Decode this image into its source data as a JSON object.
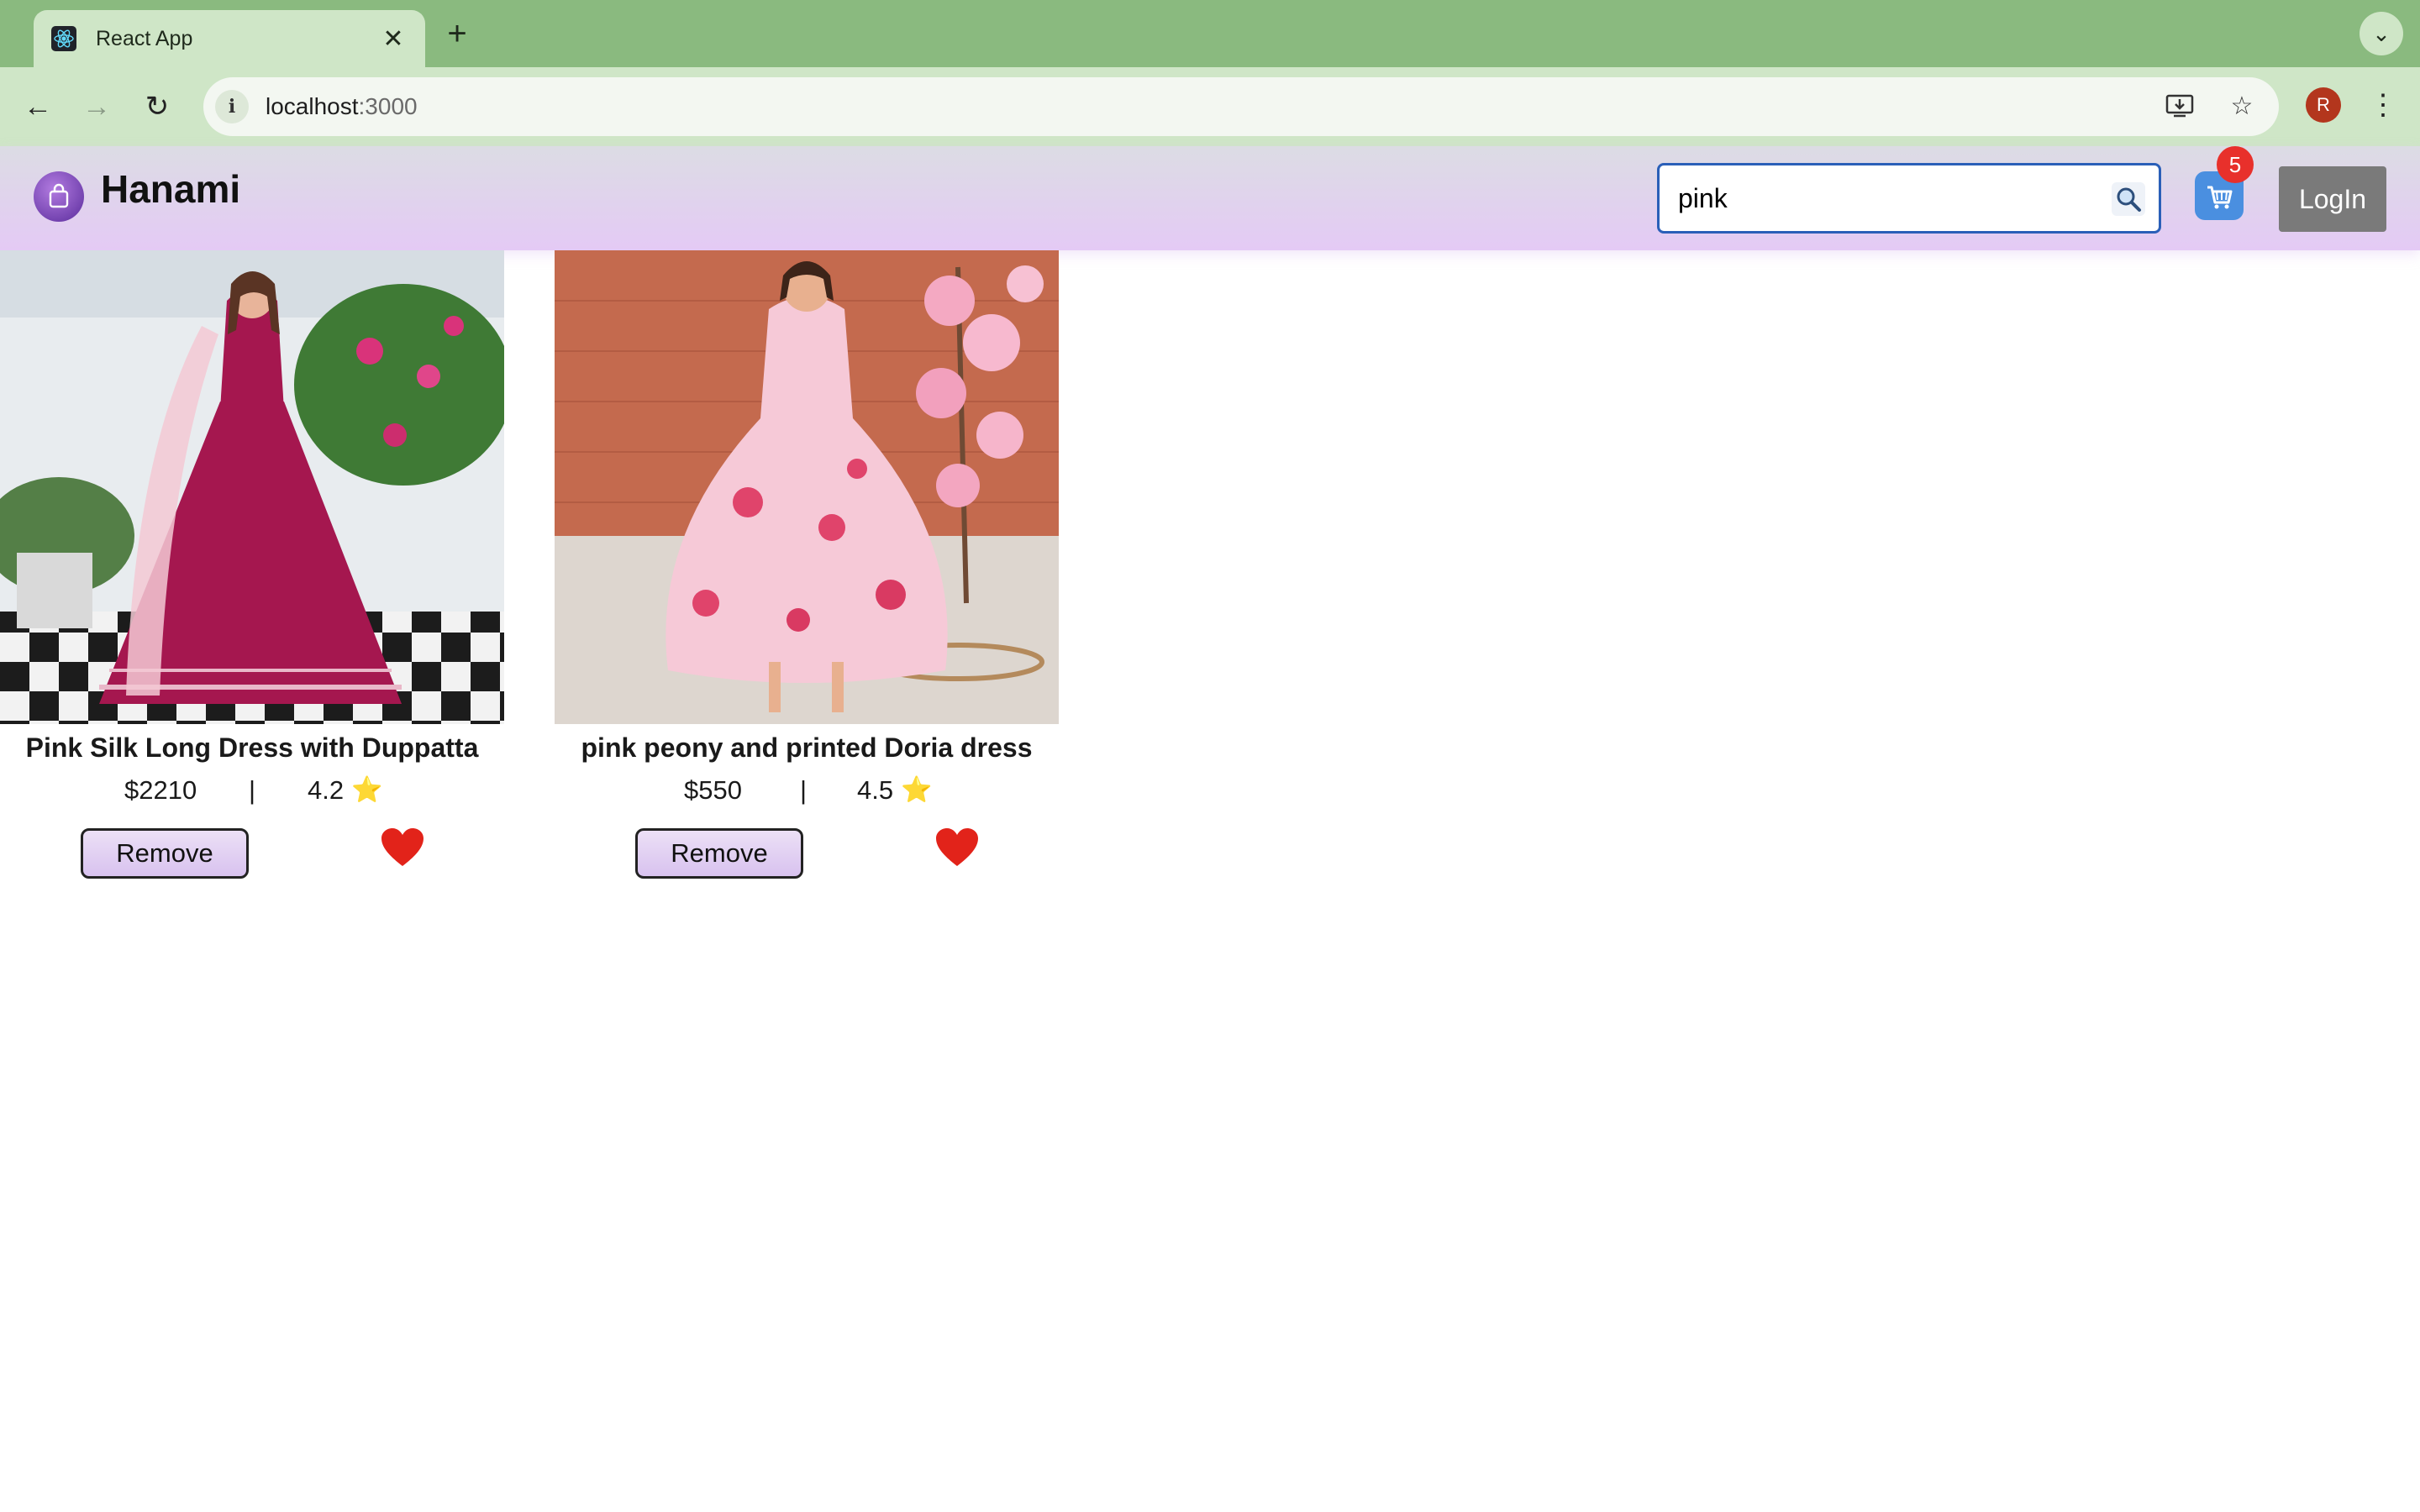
{
  "browser": {
    "tab_title": "React App",
    "url_host": "localhost",
    "url_port": ":3000",
    "profile_initial": "R"
  },
  "header": {
    "brand": "Hanami",
    "search_value": "pink",
    "cart_count": "5",
    "login_label": "LogIn"
  },
  "products": [
    {
      "name": "Pink Silk Long Dress with Duppatta",
      "price": "$2210",
      "separator": "|",
      "rating": "4.2",
      "remove_label": "Remove",
      "dress_color": "#a5174f",
      "wishlisted": true
    },
    {
      "name": "pink peony and printed Doria dress",
      "price": "$550",
      "separator": "|",
      "rating": "4.5",
      "remove_label": "Remove",
      "dress_color": "#f6c9d7",
      "wishlisted": true
    }
  ],
  "colors": {
    "accent": "#e4caf5",
    "heart": "#e2231a",
    "login": "#7a7a7a",
    "tab_bar": "#8aba7f"
  }
}
